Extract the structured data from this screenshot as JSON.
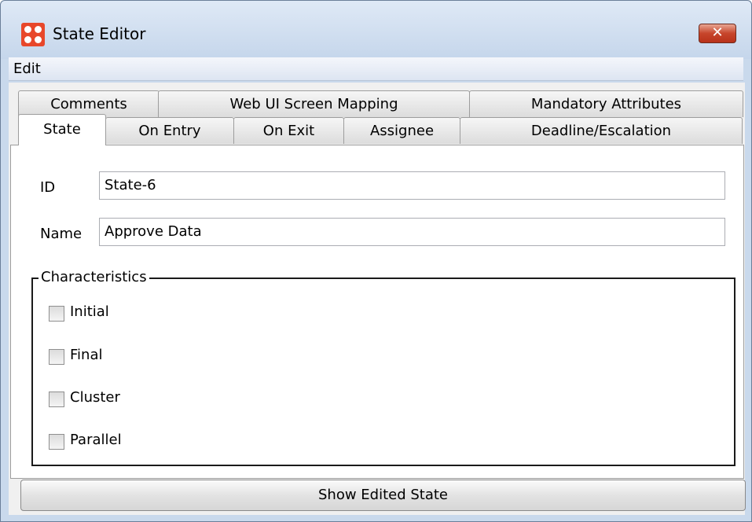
{
  "window": {
    "title": "State Editor",
    "close_glyph": "✕"
  },
  "menu": {
    "edit": "Edit"
  },
  "tabs_back": [
    "Comments",
    "Web UI Screen Mapping",
    "Mandatory Attributes"
  ],
  "tabs_front": [
    "State",
    "On Entry",
    "On Exit",
    "Assignee",
    "Deadline/Escalation"
  ],
  "active_tab": "State",
  "form": {
    "id_label": "ID",
    "id_value": "State-6",
    "name_label": "Name",
    "name_value": "Approve Data"
  },
  "characteristics": {
    "title": "Characteristics",
    "items": [
      {
        "label": "Initial",
        "checked": false
      },
      {
        "label": "Final",
        "checked": false
      },
      {
        "label": "Cluster",
        "checked": false
      },
      {
        "label": "Parallel",
        "checked": false
      }
    ]
  },
  "show_button": "Show Edited State",
  "colors": {
    "app_icon": "#e8472a",
    "close": "#c7452b",
    "title_bar": "#c5d6eb"
  },
  "icons": {
    "app": "app-logo-icon",
    "close": "close-icon"
  }
}
